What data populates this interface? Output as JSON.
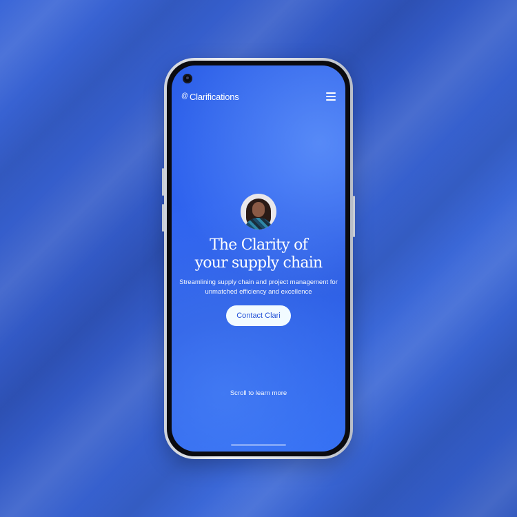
{
  "app": {
    "brand_mark": "@",
    "brand_name": "Clarifications"
  },
  "hero": {
    "headline_line1": "The Clarity of",
    "headline_line2": "your supply chain",
    "subtitle_line1": "Streamlining supply chain and project management for",
    "subtitle_line2": "unmatched efficiency and excellence",
    "cta_label": "Contact Clari"
  },
  "footer": {
    "scroll_hint": "Scroll to learn more"
  },
  "icons": {
    "menu": "hamburger-menu-icon",
    "camera": "front-camera-icon"
  },
  "colors": {
    "background": "#3157c2",
    "screen_primary": "#2c5fe8",
    "cta_background": "#f2fbff",
    "cta_text": "#1f4fd6",
    "text": "#ffffff"
  }
}
